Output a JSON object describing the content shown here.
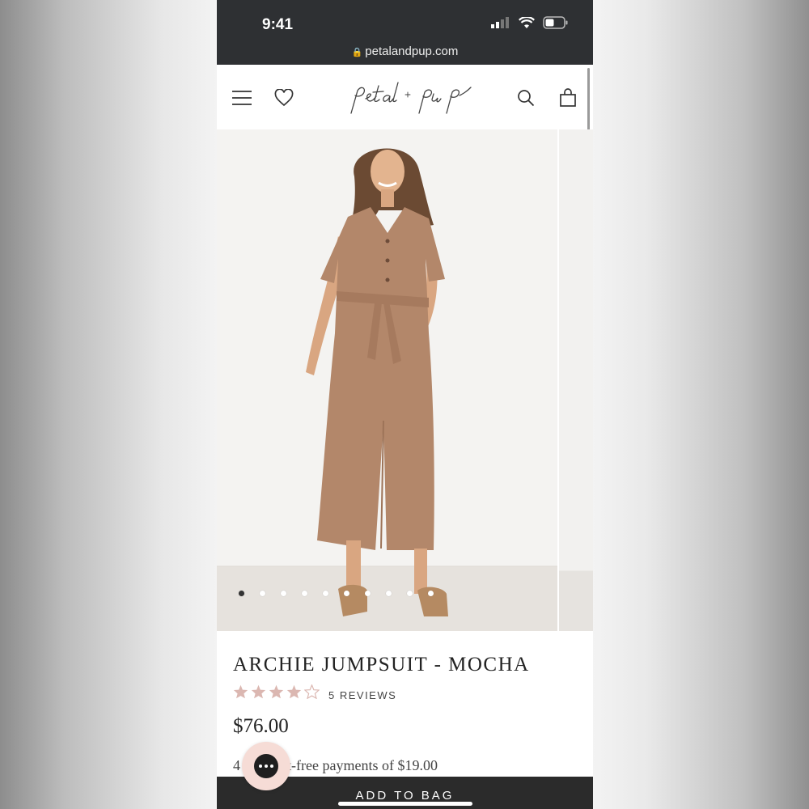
{
  "status_bar": {
    "time": "9:41",
    "icons": [
      "cellular-signal-icon",
      "wifi-icon",
      "battery-icon"
    ]
  },
  "browser": {
    "url": "petalandpup.com",
    "lock_icon": "lock-icon"
  },
  "header": {
    "logo_text": "petal + pup",
    "icons": [
      "menu-icon",
      "heart-icon",
      "search-icon",
      "shopping-bag-icon"
    ]
  },
  "gallery": {
    "image_count": 10,
    "active_index": 0,
    "image_description": "model wearing mocha short-sleeve belted jumpsuit"
  },
  "product": {
    "title": "ARCHIE JUMPSUIT - MOCHA",
    "rating": 4,
    "rating_max": 5,
    "reviews_label": "5 REVIEWS",
    "price": "$76.00",
    "installment_prefix": "4",
    "installment_text": "t-free payments of $19.00"
  },
  "actions": {
    "add_to_bag": "ADD TO BAG"
  },
  "colors": {
    "status_bar_bg": "#2e3033",
    "star_fill": "#dbb7b1",
    "chat_bg": "#f6dcd6",
    "cta_bg": "#2b2b2b",
    "garment": "#b3876a"
  }
}
